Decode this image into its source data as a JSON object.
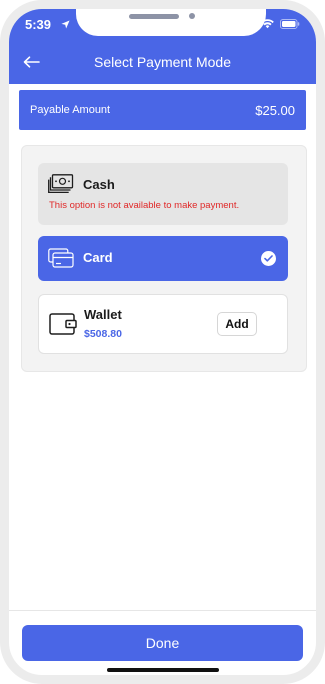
{
  "status_bar": {
    "time": "5:39"
  },
  "header": {
    "title": "Select Payment Mode"
  },
  "payable": {
    "label": "Payable Amount",
    "value": "$25.00"
  },
  "options": {
    "cash": {
      "name": "Cash",
      "note": "This option is not available to make payment.",
      "icon": "cash-icon"
    },
    "card": {
      "name": "Card",
      "selected": true,
      "icon": "card-icon"
    },
    "wallet": {
      "name": "Wallet",
      "balance": "$508.80",
      "add_label": "Add",
      "icon": "wallet-icon"
    }
  },
  "footer": {
    "done_label": "Done"
  },
  "colors": {
    "accent": "#4a66e6",
    "error": "#e02828"
  }
}
